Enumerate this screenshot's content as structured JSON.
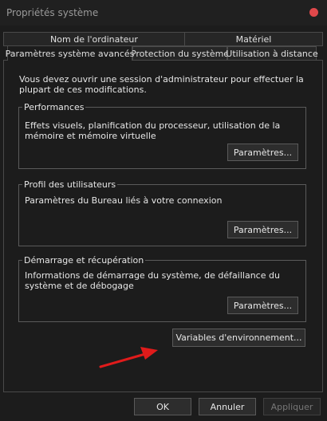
{
  "window": {
    "title": "Propriétés système"
  },
  "tabs": {
    "row1": [
      "Nom de l'ordinateur",
      "Matériel"
    ],
    "row2": [
      "Paramètres système avancés",
      "Protection du système",
      "Utilisation à distance"
    ]
  },
  "intro": "Vous devez ouvrir une session d'administrateur pour effectuer la plupart de ces modifications.",
  "performances": {
    "legend": "Performances",
    "description": "Effets visuels, planification du processeur, utilisation de la mémoire et mémoire virtuelle",
    "button": "Paramètres..."
  },
  "profiles": {
    "legend": "Profil des utilisateurs",
    "description": "Paramètres du Bureau liés à votre connexion",
    "button": "Paramètres..."
  },
  "startup": {
    "legend": "Démarrage et récupération",
    "description": "Informations de démarrage du système, de défaillance du système et de débogage",
    "button": "Paramètres..."
  },
  "env_button": "Variables d'environnement...",
  "footer": {
    "ok": "OK",
    "cancel": "Annuler",
    "apply": "Appliquer"
  },
  "colors": {
    "close_button": "#e0484b",
    "annotation_arrow": "#e01b1b"
  },
  "icons": {
    "close": "close-icon",
    "annotation": "arrow-annotation-icon"
  }
}
